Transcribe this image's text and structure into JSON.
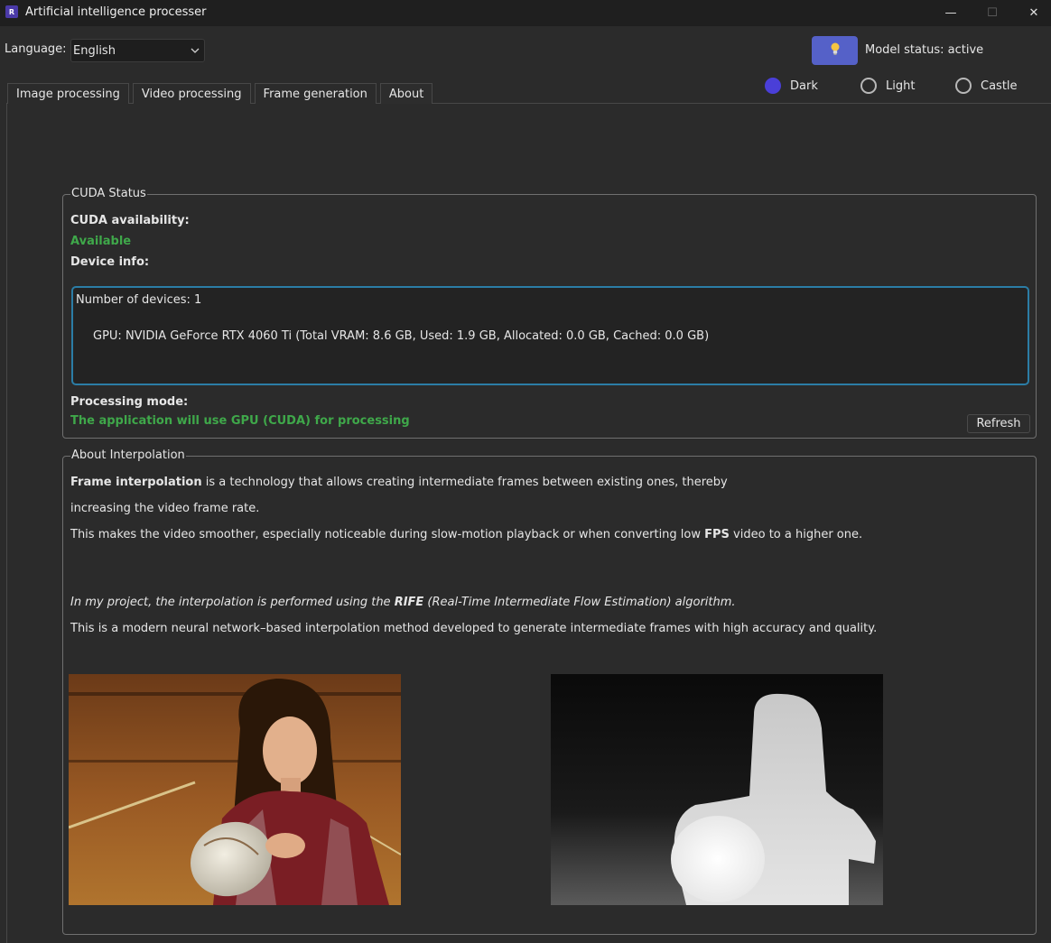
{
  "window": {
    "title": "Artificial intelligence processer",
    "app_icon_letter": "R",
    "minimize": "—",
    "maximize": "☐",
    "close": "✕"
  },
  "header": {
    "language_label": "Language:",
    "language_value": "English",
    "model_status": "Model status: active",
    "model_button_icon": "lightbulb-icon",
    "themes": [
      {
        "label": "Dark",
        "selected": true
      },
      {
        "label": "Light",
        "selected": false
      },
      {
        "label": "Castle",
        "selected": false
      }
    ]
  },
  "tabs": [
    {
      "label": "Image processing"
    },
    {
      "label": "Video processing"
    },
    {
      "label": "Frame generation"
    },
    {
      "label": "About",
      "active": true
    }
  ],
  "cuda": {
    "group_title": "CUDA Status",
    "availability_label": "CUDA availability:",
    "availability_value": "Available",
    "device_info_label": "Device info:",
    "device_count": "Number of devices: 1",
    "gpu_line": "GPU: NVIDIA GeForce RTX 4060 Ti (Total VRAM: 8.6 GB, Used: 1.9 GB, Allocated: 0.0 GB, Cached: 0.0 GB)",
    "processing_mode_label": "Processing mode:",
    "processing_mode_value": "The application will use GPU (CUDA) for processing",
    "refresh_label": "Refresh"
  },
  "about": {
    "group_title": "About Interpolation",
    "p1_bold": "Frame interpolation",
    "p1_rest": " is a technology that allows creating intermediate frames between existing ones, thereby",
    "p2": "increasing the video frame rate.",
    "p3_pre": "This makes the video smoother, especially noticeable during slow-motion playback or when converting low ",
    "p3_bold": "FPS",
    "p3_post": " video to a higher one.",
    "p4_pre": "In my project, the interpolation is performed using the ",
    "p4_bold": "RIFE",
    "p4_post": " (Real-Time Intermediate Flow Estimation) algorithm.",
    "p5": "This is a modern neural network–based interpolation method developed to generate intermediate frames with high accuracy and quality."
  },
  "colors": {
    "background": "#2b2b2b",
    "accent": "#4a3fd8",
    "model_button": "#5561c8",
    "success": "#3fa84a",
    "focus_border": "#2b7da6"
  }
}
